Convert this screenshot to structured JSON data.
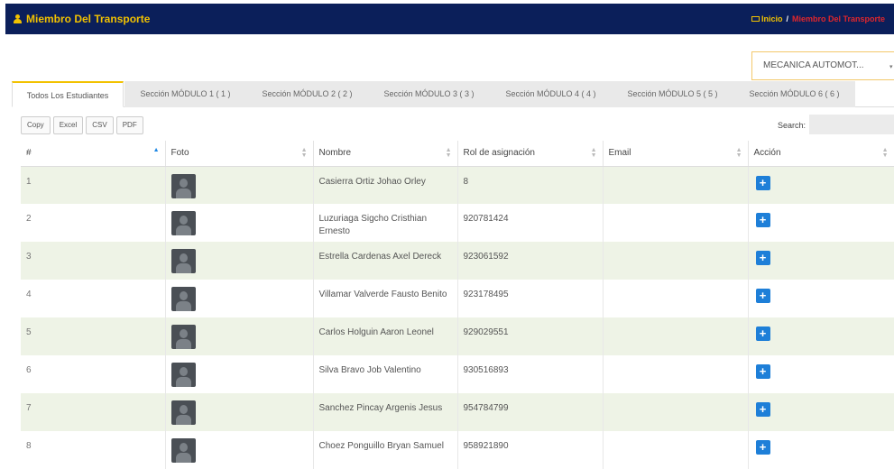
{
  "header": {
    "title": "Miembro Del Transporte",
    "breadcrumb_home": "Inicio",
    "breadcrumb_sep": "/",
    "breadcrumb_current": "Miembro Del Transporte"
  },
  "select": {
    "value": "MECANICA AUTOMOT...",
    "arrow": "▾"
  },
  "tabs": [
    {
      "label": "Todos Los Estudiantes"
    },
    {
      "label": "Sección MÓDULO 1 ( 1 )"
    },
    {
      "label": "Sección MÓDULO 2 ( 2 )"
    },
    {
      "label": "Sección MÓDULO 3 ( 3 )"
    },
    {
      "label": "Sección MÓDULO 4 ( 4 )"
    },
    {
      "label": "Sección MÓDULO 5 ( 5 )"
    },
    {
      "label": "Sección MÓDULO 6 ( 6 )"
    }
  ],
  "toolbar": {
    "copy": "Copy",
    "excel": "Excel",
    "csv": "CSV",
    "pdf": "PDF",
    "search_label": "Search:"
  },
  "table": {
    "columns": [
      "#",
      "Foto",
      "Nombre",
      "Rol de asignación",
      "Email",
      "Acción"
    ],
    "rows": [
      {
        "num": "1",
        "nombre": "Casierra Ortiz Johao Orley",
        "rol": "8",
        "email": ""
      },
      {
        "num": "2",
        "nombre": "Luzuriaga Sigcho Cristhian Ernesto",
        "rol": "920781424",
        "email": ""
      },
      {
        "num": "3",
        "nombre": "Estrella Cardenas Axel Dereck",
        "rol": "923061592",
        "email": ""
      },
      {
        "num": "4",
        "nombre": "Villamar Valverde Fausto Benito",
        "rol": "923178495",
        "email": ""
      },
      {
        "num": "5",
        "nombre": "Carlos Holguin Aaron Leonel",
        "rol": "929029551",
        "email": ""
      },
      {
        "num": "6",
        "nombre": "Silva Bravo Job Valentino",
        "rol": "930516893",
        "email": ""
      },
      {
        "num": "7",
        "nombre": "Sanchez Pincay Argenis Jesus",
        "rol": "954784799",
        "email": ""
      },
      {
        "num": "8",
        "nombre": "Choez Ponguillo Bryan Samuel",
        "rol": "958921890",
        "email": ""
      }
    ],
    "add_symbol": "+"
  },
  "colors": {
    "navbar": "#0b1f5a",
    "brand": "#f2c200",
    "breadcrumb_current": "#e0262c",
    "row_stripe": "#eef3e6",
    "add_button": "#1e7fd8"
  }
}
